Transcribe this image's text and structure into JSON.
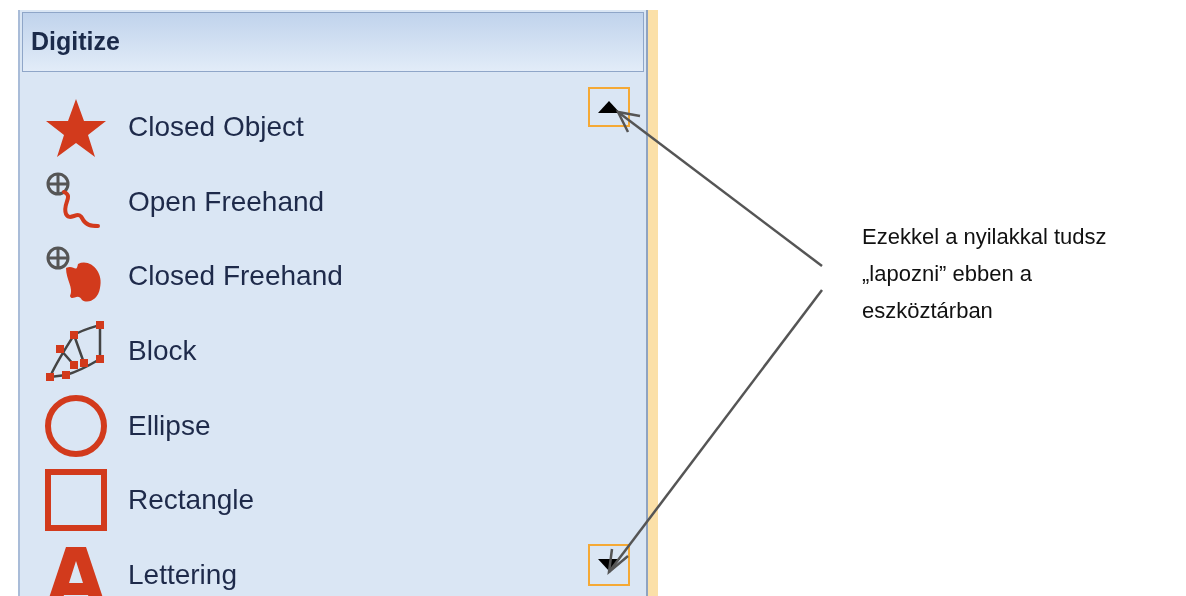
{
  "panel": {
    "title": "Digitize",
    "items": [
      {
        "kind": "star",
        "label": "Closed Object"
      },
      {
        "kind": "open-freehand",
        "label": "Open Freehand"
      },
      {
        "kind": "closed-freehand",
        "label": "Closed Freehand"
      },
      {
        "kind": "block",
        "label": "Block"
      },
      {
        "kind": "ellipse",
        "label": "Ellipse"
      },
      {
        "kind": "rectangle",
        "label": "Rectangle"
      },
      {
        "kind": "lettering",
        "label": "Lettering"
      }
    ]
  },
  "annotation": {
    "text": "Ezekkel a nyilakkal tudsz „lapozni” ebben a eszköztárban"
  }
}
